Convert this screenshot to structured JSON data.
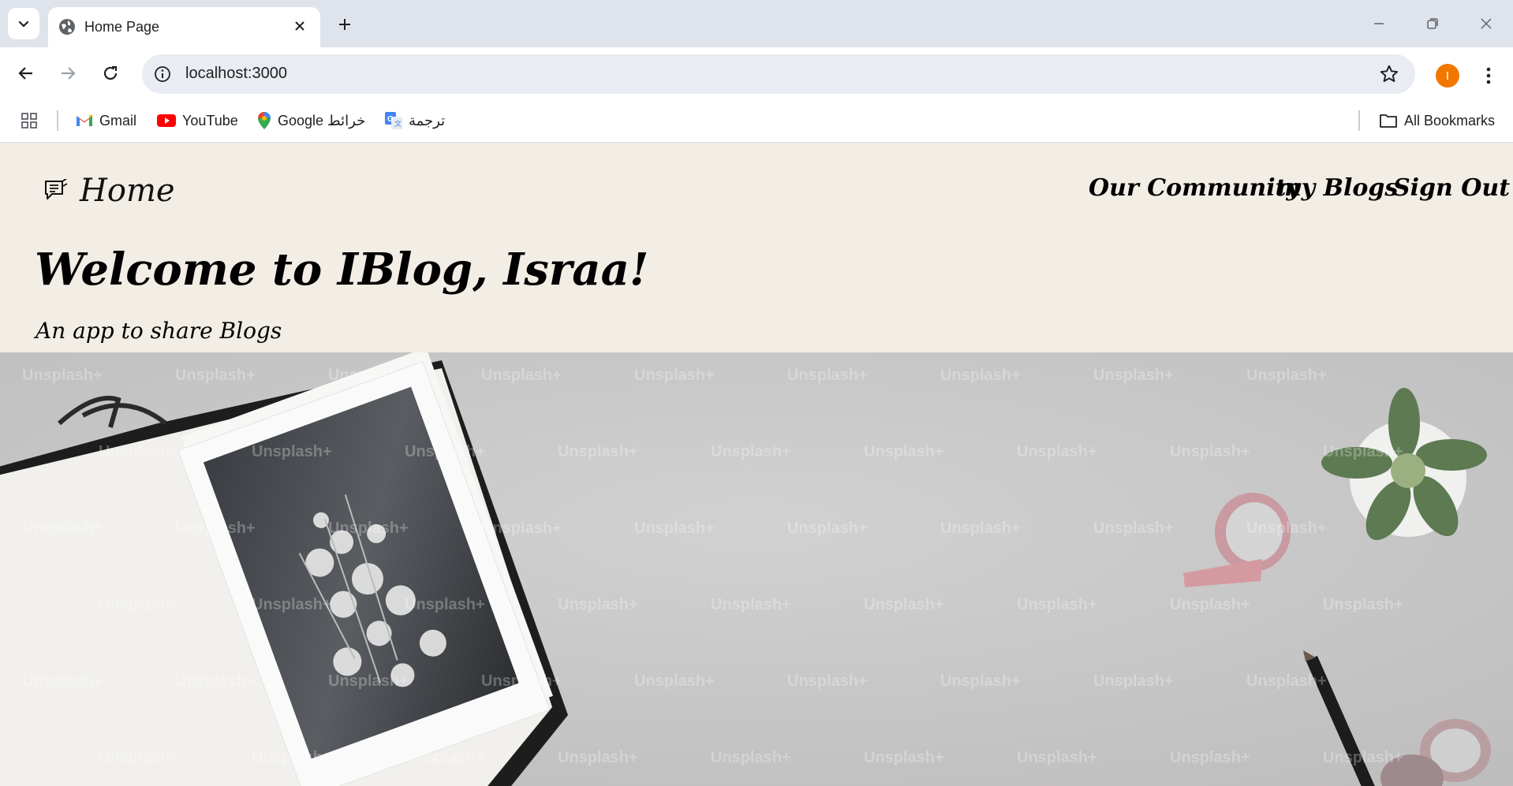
{
  "browser": {
    "tab_title": "Home Page",
    "url": "localhost:3000",
    "profile_initial": "I",
    "bookmarks": [
      "Gmail",
      "YouTube",
      "Google خرائط",
      "ترجمة"
    ],
    "all_bookmarks_label": "All Bookmarks"
  },
  "site": {
    "brand": "Home",
    "nav": [
      "Our Community",
      "my Blogs",
      "Sign Out"
    ],
    "welcome": "Welcome to IBlog, Israa!",
    "tagline": "An app to share Blogs",
    "watermark": "Unsplash+"
  },
  "colors": {
    "header_bg": "#f2ede5",
    "tabstrip_bg": "#dfe3eb",
    "profile": "#f07800"
  }
}
